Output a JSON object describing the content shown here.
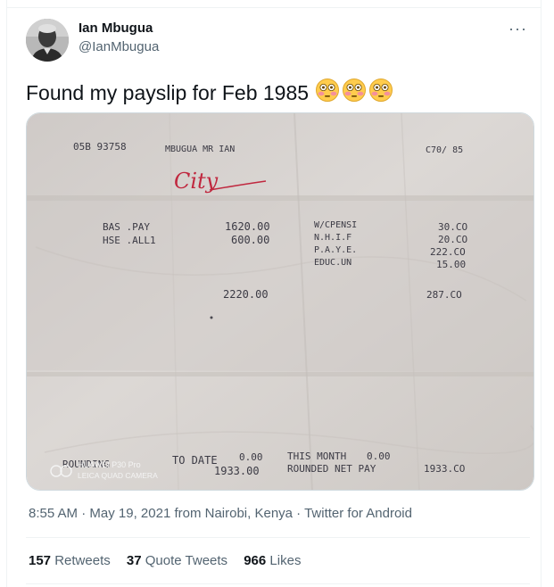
{
  "user": {
    "name": "Ian Mbugua",
    "handle": "@IanMbugua"
  },
  "tweet": {
    "text": "Found my payslip for Feb 1985",
    "emojis": [
      "flushed-face-emoji",
      "flushed-face-emoji",
      "flushed-face-emoji"
    ],
    "more_label": "···"
  },
  "payslip": {
    "code": "05B  93758",
    "employee": "MBUGUA MR IAN",
    "period": "C70/  85",
    "handwritten": "City",
    "earnings": [
      {
        "label": "BAS .PAY",
        "amount": "1620.00"
      },
      {
        "label": "HSE .ALL1",
        "amount": "600.00"
      }
    ],
    "deductions": [
      {
        "label": "W/CPENSI",
        "amount": "30.CO"
      },
      {
        "label": "N.H.I.F",
        "amount": "20.CO"
      },
      {
        "label": "P.A.Y.E.",
        "amount": "222.CO"
      },
      {
        "label": "EDUC.UN",
        "amount": "15.00"
      }
    ],
    "total_earnings": "2220.00",
    "total_deductions": "287.CO",
    "footer": {
      "to_date_label": "TO DATE",
      "to_date_left": "ROUNDING",
      "to_date_value": "0.00",
      "to_date_value2": "1933.00",
      "this_month_label": "THIS MONTH",
      "this_month_value": "0.00",
      "rounded_label": "ROUNDED NET PAY",
      "net_pay": "1933.CO"
    },
    "camera_watermark": {
      "line1": "HUAWEI P30 Pro",
      "line2": "LEICA QUAD CAMERA"
    }
  },
  "meta": {
    "time": "8:55 AM",
    "sep": " · ",
    "date": "May 19, 2021 from Nairobi, Kenya",
    "source": "Twitter for Android"
  },
  "stats": [
    {
      "count": "157",
      "label": "Retweets"
    },
    {
      "count": "37",
      "label": "Quote Tweets"
    },
    {
      "count": "966",
      "label": "Likes"
    }
  ],
  "colors": {
    "text": "#0f1419",
    "secondary": "#536471",
    "paper": "#d8d3cf",
    "ink": "#3b3a44",
    "handwriting": "#c0283f"
  }
}
